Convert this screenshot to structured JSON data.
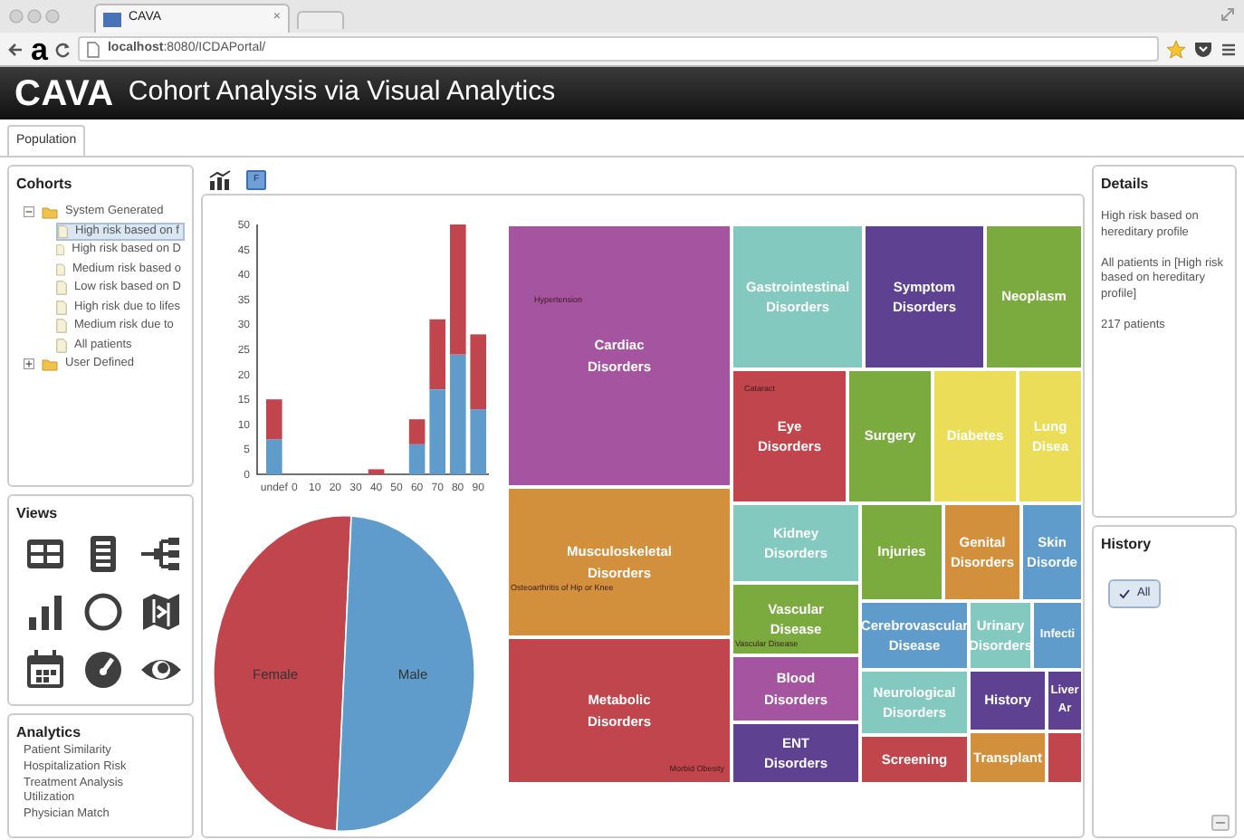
{
  "browser": {
    "panel_label": "a",
    "tab_title": "CAVA",
    "tab_close": "×",
    "url": "**localhost**:8080/ICDAPortal/"
  },
  "header": {
    "logo": "CAVA",
    "subtitle": "Cohort Analysis via Visual Analytics"
  },
  "tabs": [
    {
      "label": "Population",
      "selected": true
    }
  ],
  "cohorts": {
    "title": "Cohorts",
    "tree": [
      {
        "label": "System Generated",
        "expanded": true,
        "children": [
          {
            "label": "High risk based on f",
            "selected": true
          },
          {
            "label": "High risk based on D",
            "selected": false
          },
          {
            "label": "Medium risk based o",
            "selected": false
          },
          {
            "label": "Low risk based on D",
            "selected": false
          },
          {
            "label": "High risk due to lifes",
            "selected": false
          },
          {
            "label": "Medium risk due to",
            "selected": false
          },
          {
            "label": "All patients",
            "selected": false
          }
        ]
      },
      {
        "label": "User Defined",
        "expanded": false
      }
    ]
  },
  "views": {
    "title": "Views"
  },
  "analytics": {
    "title": "Analytics",
    "items": [
      "Patient Similarity",
      "Hospitalization Risk",
      "Treatment Analysis",
      "Utilization",
      "Physician Match"
    ]
  },
  "toolbar": {
    "filter_button": "F"
  },
  "bar_chart": {
    "chart_data": {
      "type": "bar",
      "stacked": true,
      "categories": [
        "undef",
        "0",
        "10",
        "20",
        "30",
        "40",
        "50",
        "60",
        "70",
        "80",
        "90"
      ],
      "series": [
        {
          "color": "#5f9ccb",
          "values": [
            7,
            0,
            0,
            0,
            0,
            0,
            0,
            6,
            17,
            24,
            13
          ]
        },
        {
          "color": "#c1454d",
          "values": [
            8,
            0,
            0,
            0,
            0,
            1,
            0,
            5,
            14,
            26,
            15
          ]
        }
      ],
      "ylim": [
        0,
        50
      ],
      "yticks": [
        0,
        5,
        10,
        15,
        20,
        25,
        30,
        35,
        40,
        45,
        50
      ]
    }
  },
  "pie": {
    "slices": [
      {
        "label": "Female",
        "color": "#c1454d"
      },
      {
        "label": "Male",
        "color": "#5f9ccb"
      }
    ]
  },
  "treemap": {
    "tiles": [
      {
        "label": "Cardiac Disorders",
        "color": "#a5559f",
        "note": "Hypertension"
      },
      {
        "label": "Musculoskeletal Disorders",
        "color": "#d28f3c",
        "note": "Osteoarthritis of Hip or Knee"
      },
      {
        "label": "Metabolic Disorders",
        "color": "#c1454d",
        "note": "Morbid Obesity"
      },
      {
        "label": "Gastrointestinal Disorders",
        "color": "#83c9bf"
      },
      {
        "label": "Symptom Disorders",
        "color": "#5f4192"
      },
      {
        "label": "Neoplasm",
        "color": "#7bab3f"
      },
      {
        "label": "Eye Disorders",
        "color": "#c1454d",
        "note": "Cataract"
      },
      {
        "label": "Surgery",
        "color": "#7bab3f"
      },
      {
        "label": "Diabetes",
        "color": "#ebdd58"
      },
      {
        "label": "Lung Disea",
        "color": "#ebdd58"
      },
      {
        "label": "Kidney Disorders",
        "color": "#83c9bf"
      },
      {
        "label": "Vascular Disease",
        "color": "#7bab3f",
        "note": "Vascular Disease"
      },
      {
        "label": "Blood Disorders",
        "color": "#a5559f"
      },
      {
        "label": "ENT Disorders",
        "color": "#5f4192"
      },
      {
        "label": "Injuries",
        "color": "#7bab3f"
      },
      {
        "label": "Genital Disorders",
        "color": "#d28f3c"
      },
      {
        "label": "Skin Disorde",
        "color": "#5f9ccb"
      },
      {
        "label": "Cerebrovascular Disease",
        "color": "#5f9ccb"
      },
      {
        "label": "Urinary Disorders",
        "color": "#83c9bf"
      },
      {
        "label": "Infecti",
        "color": "#5f9ccb"
      },
      {
        "label": "Neurological Disorders",
        "color": "#83c9bf"
      },
      {
        "label": "Screening",
        "color": "#c1454d"
      },
      {
        "label": "History",
        "color": "#5f4192"
      },
      {
        "label": "Liver Ar",
        "color": "#5f4192"
      },
      {
        "label": "Transplant",
        "color": "#d28f3c"
      },
      {
        "color": "#c1454d"
      }
    ]
  },
  "details": {
    "title": "Details",
    "lines": [
      "High risk based on hereditary profile",
      "All patients in [High risk based on hereditary profile]",
      "217 patients"
    ]
  },
  "history": {
    "title": "History",
    "items": [
      {
        "label": "All",
        "checked": true
      }
    ]
  }
}
